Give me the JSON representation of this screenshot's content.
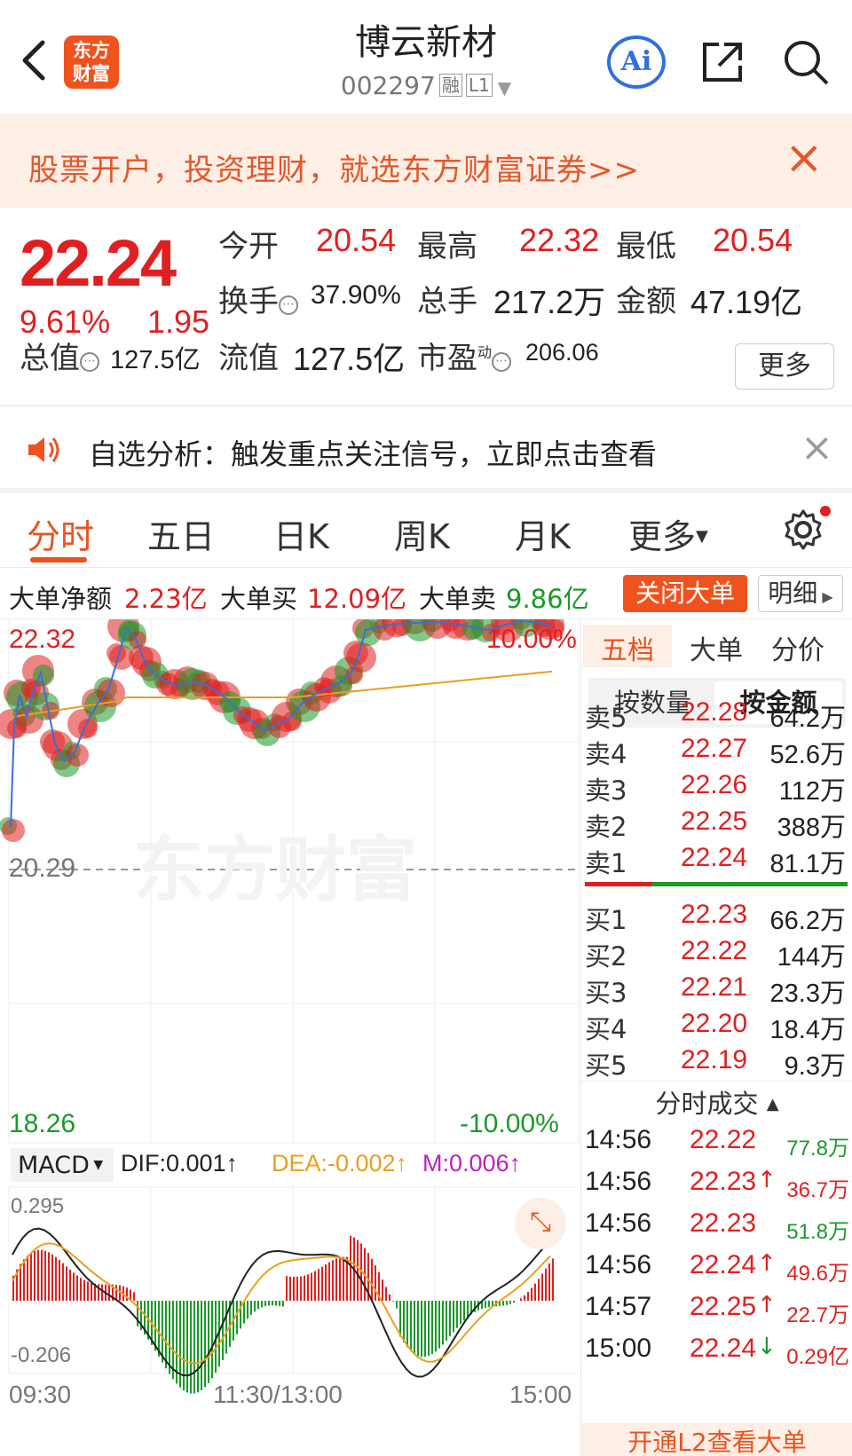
{
  "header": {
    "logo_line1": "东方",
    "logo_line2": "财富",
    "stock_name": "博云新材",
    "stock_code": "002297",
    "tag_margin": "融",
    "tag_level": "L1",
    "ai_label": "Ai"
  },
  "promo": {
    "text": "股票开户，投资理财，就选东方财富证券>>"
  },
  "quote": {
    "price": "22.24",
    "change_pct": "9.61%",
    "change": "1.95",
    "fields": {
      "open_label": "今开",
      "open_value": "20.54",
      "high_label": "最高",
      "high_value": "22.32",
      "low_label": "最低",
      "low_value": "20.54",
      "turnover_label": "换手",
      "turnover_value": "37.90%",
      "volume_label": "总手",
      "volume_value": "217.2万",
      "amount_label": "金额",
      "amount_value": "47.19亿",
      "mktcap_label": "总值",
      "mktcap_value": "127.5亿",
      "float_label": "流值",
      "float_value": "127.5亿",
      "pe_label": "市盈",
      "pe_sup": "动",
      "pe_value": "206.06"
    },
    "more_label": "更多"
  },
  "alert": {
    "text": "自选分析：触发重点关注信号，立即点击查看"
  },
  "tabs": {
    "items": [
      "分时",
      "五日",
      "日K",
      "周K",
      "月K",
      "更多"
    ],
    "active": "分时"
  },
  "big_orders": {
    "net_label": "大单净额",
    "net_value": "2.23亿",
    "buy_label": "大单买",
    "buy_value": "12.09亿",
    "sell_label": "大单卖",
    "sell_value": "9.86亿",
    "close_label": "关闭大单",
    "detail_label": "明细"
  },
  "chart": {
    "price_high": "22.32",
    "price_mid": "20.29",
    "price_low": "18.26",
    "pct_high": "10.00%",
    "pct_low": "-10.00%",
    "watermark": "东方财富",
    "macd_label": "MACD",
    "dif_label": "DIF:0.001",
    "dea_label": "DEA:-0.002",
    "m_label": "M:0.006",
    "macd_high": "0.295",
    "macd_low": "-0.206",
    "time_start": "09:30",
    "time_mid": "11:30/13:00",
    "time_end": "15:00",
    "colors": {
      "up": "#e02020",
      "down": "#1a9a2a",
      "avg": "#e8a020",
      "dea": "#e8a020",
      "m": "#c020c0"
    }
  },
  "order_panel": {
    "tabs": [
      "五档",
      "大单",
      "分价"
    ],
    "toggle_left": "按数量",
    "toggle_right": "按金额",
    "asks": [
      {
        "label": "卖5",
        "price": "22.28",
        "value": "64.2万"
      },
      {
        "label": "卖4",
        "price": "22.27",
        "value": "52.6万"
      },
      {
        "label": "卖3",
        "price": "22.26",
        "value": "112万"
      },
      {
        "label": "卖2",
        "price": "22.25",
        "value": "388万"
      },
      {
        "label": "卖1",
        "price": "22.24",
        "value": "81.1万"
      }
    ],
    "bids": [
      {
        "label": "买1",
        "price": "22.23",
        "value": "66.2万"
      },
      {
        "label": "买2",
        "price": "22.22",
        "value": "144万"
      },
      {
        "label": "买3",
        "price": "22.21",
        "value": "23.3万"
      },
      {
        "label": "买4",
        "price": "22.20",
        "value": "18.4万"
      },
      {
        "label": "买5",
        "price": "22.19",
        "value": "9.3万"
      }
    ],
    "trades_header": "分时成交",
    "trades": [
      {
        "time": "14:56",
        "price": "22.22",
        "arrow": "",
        "value": "77.8万",
        "color": "#1a9a2a"
      },
      {
        "time": "14:56",
        "price": "22.23",
        "arrow": "↑",
        "value": "36.7万",
        "color": "#e02020"
      },
      {
        "time": "14:56",
        "price": "22.23",
        "arrow": "",
        "value": "51.8万",
        "color": "#1a9a2a"
      },
      {
        "time": "14:56",
        "price": "22.24",
        "arrow": "↑",
        "value": "49.6万",
        "color": "#e02020"
      },
      {
        "time": "14:57",
        "price": "22.25",
        "arrow": "↑",
        "value": "22.7万",
        "color": "#e02020"
      },
      {
        "time": "15:00",
        "price": "22.24",
        "arrow": "↓",
        "value": "0.29亿",
        "color": "#e02020"
      }
    ],
    "l2_banner": "开通L2查看大单"
  }
}
